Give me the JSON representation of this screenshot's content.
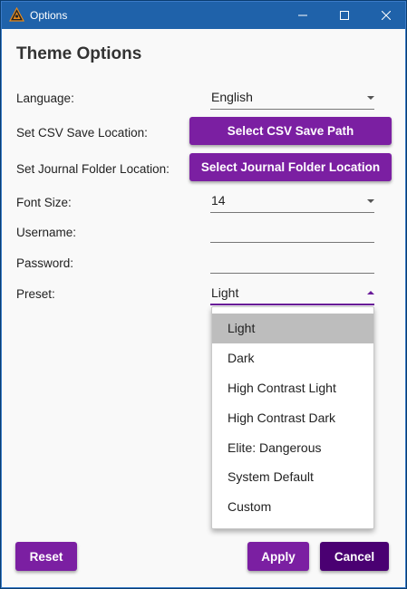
{
  "window": {
    "title": "Options",
    "minimize_icon": "minimize-icon",
    "maximize_icon": "maximize-icon",
    "close_icon": "close-icon"
  },
  "heading": "Theme Options",
  "fields": {
    "language": {
      "label": "Language:",
      "value": "English"
    },
    "csv": {
      "label": "Set CSV Save Location:",
      "button": "Select CSV Save Path"
    },
    "journal": {
      "label": "Set Journal Folder Location:",
      "button": "Select Journal Folder Location"
    },
    "font_size": {
      "label": "Font Size:",
      "value": "14"
    },
    "username": {
      "label": "Username:",
      "value": ""
    },
    "password": {
      "label": "Password:",
      "value": ""
    },
    "preset": {
      "label": "Preset:",
      "value": "Light"
    }
  },
  "preset_options": [
    {
      "label": "Light",
      "selected": true
    },
    {
      "label": "Dark",
      "selected": false
    },
    {
      "label": "High Contrast Light",
      "selected": false
    },
    {
      "label": "High Contrast Dark",
      "selected": false
    },
    {
      "label": "Elite: Dangerous",
      "selected": false
    },
    {
      "label": "System Default",
      "selected": false
    },
    {
      "label": "Custom",
      "selected": false
    }
  ],
  "footer": {
    "reset": "Reset",
    "apply": "Apply",
    "cancel": "Cancel"
  },
  "colors": {
    "accent": "#7b1fa2",
    "accent_dark": "#4a0072",
    "titlebar": "#1f62aa"
  }
}
